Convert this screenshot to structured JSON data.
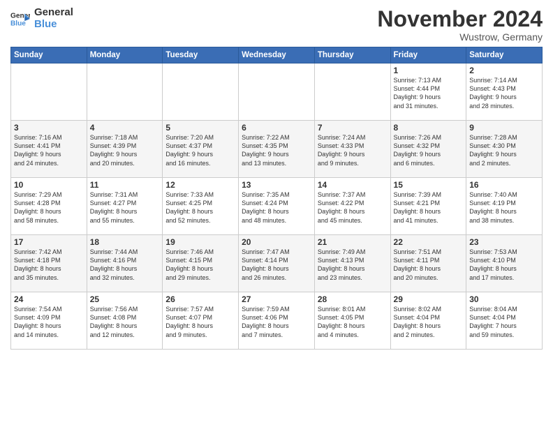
{
  "logo": {
    "line1": "General",
    "line2": "Blue"
  },
  "title": "November 2024",
  "location": "Wustrow, Germany",
  "headers": [
    "Sunday",
    "Monday",
    "Tuesday",
    "Wednesday",
    "Thursday",
    "Friday",
    "Saturday"
  ],
  "weeks": [
    [
      {
        "num": "",
        "info": ""
      },
      {
        "num": "",
        "info": ""
      },
      {
        "num": "",
        "info": ""
      },
      {
        "num": "",
        "info": ""
      },
      {
        "num": "",
        "info": ""
      },
      {
        "num": "1",
        "info": "Sunrise: 7:13 AM\nSunset: 4:44 PM\nDaylight: 9 hours\nand 31 minutes."
      },
      {
        "num": "2",
        "info": "Sunrise: 7:14 AM\nSunset: 4:43 PM\nDaylight: 9 hours\nand 28 minutes."
      }
    ],
    [
      {
        "num": "3",
        "info": "Sunrise: 7:16 AM\nSunset: 4:41 PM\nDaylight: 9 hours\nand 24 minutes."
      },
      {
        "num": "4",
        "info": "Sunrise: 7:18 AM\nSunset: 4:39 PM\nDaylight: 9 hours\nand 20 minutes."
      },
      {
        "num": "5",
        "info": "Sunrise: 7:20 AM\nSunset: 4:37 PM\nDaylight: 9 hours\nand 16 minutes."
      },
      {
        "num": "6",
        "info": "Sunrise: 7:22 AM\nSunset: 4:35 PM\nDaylight: 9 hours\nand 13 minutes."
      },
      {
        "num": "7",
        "info": "Sunrise: 7:24 AM\nSunset: 4:33 PM\nDaylight: 9 hours\nand 9 minutes."
      },
      {
        "num": "8",
        "info": "Sunrise: 7:26 AM\nSunset: 4:32 PM\nDaylight: 9 hours\nand 6 minutes."
      },
      {
        "num": "9",
        "info": "Sunrise: 7:28 AM\nSunset: 4:30 PM\nDaylight: 9 hours\nand 2 minutes."
      }
    ],
    [
      {
        "num": "10",
        "info": "Sunrise: 7:29 AM\nSunset: 4:28 PM\nDaylight: 8 hours\nand 58 minutes."
      },
      {
        "num": "11",
        "info": "Sunrise: 7:31 AM\nSunset: 4:27 PM\nDaylight: 8 hours\nand 55 minutes."
      },
      {
        "num": "12",
        "info": "Sunrise: 7:33 AM\nSunset: 4:25 PM\nDaylight: 8 hours\nand 52 minutes."
      },
      {
        "num": "13",
        "info": "Sunrise: 7:35 AM\nSunset: 4:24 PM\nDaylight: 8 hours\nand 48 minutes."
      },
      {
        "num": "14",
        "info": "Sunrise: 7:37 AM\nSunset: 4:22 PM\nDaylight: 8 hours\nand 45 minutes."
      },
      {
        "num": "15",
        "info": "Sunrise: 7:39 AM\nSunset: 4:21 PM\nDaylight: 8 hours\nand 41 minutes."
      },
      {
        "num": "16",
        "info": "Sunrise: 7:40 AM\nSunset: 4:19 PM\nDaylight: 8 hours\nand 38 minutes."
      }
    ],
    [
      {
        "num": "17",
        "info": "Sunrise: 7:42 AM\nSunset: 4:18 PM\nDaylight: 8 hours\nand 35 minutes."
      },
      {
        "num": "18",
        "info": "Sunrise: 7:44 AM\nSunset: 4:16 PM\nDaylight: 8 hours\nand 32 minutes."
      },
      {
        "num": "19",
        "info": "Sunrise: 7:46 AM\nSunset: 4:15 PM\nDaylight: 8 hours\nand 29 minutes."
      },
      {
        "num": "20",
        "info": "Sunrise: 7:47 AM\nSunset: 4:14 PM\nDaylight: 8 hours\nand 26 minutes."
      },
      {
        "num": "21",
        "info": "Sunrise: 7:49 AM\nSunset: 4:13 PM\nDaylight: 8 hours\nand 23 minutes."
      },
      {
        "num": "22",
        "info": "Sunrise: 7:51 AM\nSunset: 4:11 PM\nDaylight: 8 hours\nand 20 minutes."
      },
      {
        "num": "23",
        "info": "Sunrise: 7:53 AM\nSunset: 4:10 PM\nDaylight: 8 hours\nand 17 minutes."
      }
    ],
    [
      {
        "num": "24",
        "info": "Sunrise: 7:54 AM\nSunset: 4:09 PM\nDaylight: 8 hours\nand 14 minutes."
      },
      {
        "num": "25",
        "info": "Sunrise: 7:56 AM\nSunset: 4:08 PM\nDaylight: 8 hours\nand 12 minutes."
      },
      {
        "num": "26",
        "info": "Sunrise: 7:57 AM\nSunset: 4:07 PM\nDaylight: 8 hours\nand 9 minutes."
      },
      {
        "num": "27",
        "info": "Sunrise: 7:59 AM\nSunset: 4:06 PM\nDaylight: 8 hours\nand 7 minutes."
      },
      {
        "num": "28",
        "info": "Sunrise: 8:01 AM\nSunset: 4:05 PM\nDaylight: 8 hours\nand 4 minutes."
      },
      {
        "num": "29",
        "info": "Sunrise: 8:02 AM\nSunset: 4:04 PM\nDaylight: 8 hours\nand 2 minutes."
      },
      {
        "num": "30",
        "info": "Sunrise: 8:04 AM\nSunset: 4:04 PM\nDaylight: 7 hours\nand 59 minutes."
      }
    ]
  ]
}
